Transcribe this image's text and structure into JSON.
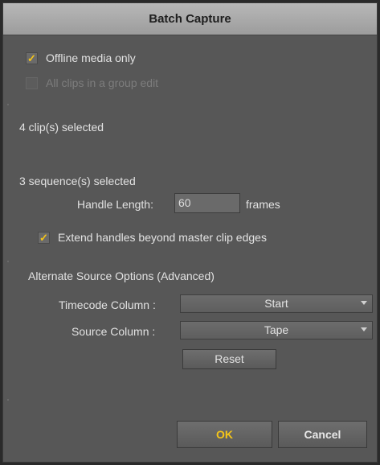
{
  "dialog": {
    "title": "Batch Capture"
  },
  "options": {
    "offline_media_only": {
      "label": "Offline media only",
      "checked": true
    },
    "all_clips_group_edit": {
      "label": "All clips in a group edit",
      "checked": false,
      "enabled": false
    }
  },
  "status": {
    "clips_selected": "4 clip(s) selected",
    "sequences_selected": "3 sequence(s) selected"
  },
  "handle": {
    "label": "Handle Length:",
    "value": "60",
    "unit": "frames"
  },
  "extend_handles": {
    "label": "Extend handles beyond master clip edges",
    "checked": true
  },
  "alternate_source": {
    "heading": "Alternate Source Options (Advanced)",
    "timecode_label": "Timecode Column :",
    "timecode_value": "Start",
    "source_label": "Source Column :",
    "source_value": "Tape",
    "reset_label": "Reset"
  },
  "buttons": {
    "ok_label": "OK",
    "cancel_label": "Cancel"
  },
  "icons": {
    "checkmark": "checkmark-icon",
    "dropdown": "chevron-down-icon"
  },
  "colors": {
    "accent": "#f5c518",
    "panel": "#575757",
    "titlebar": "#a8a8a8"
  }
}
